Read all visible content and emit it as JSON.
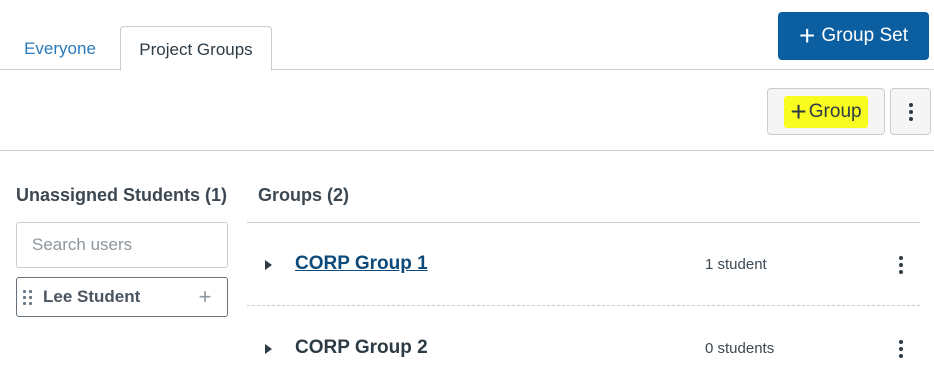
{
  "tabs": {
    "everyone": "Everyone",
    "project_groups": "Project Groups"
  },
  "header": {
    "add_group_set_label": "Group Set",
    "add_group_set_icon": "plus-icon"
  },
  "toolbar": {
    "add_group_label": "Group",
    "add_group_icon": "plus-icon",
    "more_icon": "kebab-icon",
    "highlight_color": "#f8fc1f"
  },
  "unassigned": {
    "title": "Unassigned Students (1)",
    "search_placeholder": "Search users",
    "students": [
      {
        "name": "Lee Student"
      }
    ]
  },
  "groups": {
    "title": "Groups (2)",
    "items": [
      {
        "name": "CORP Group 1",
        "count": "1 student"
      },
      {
        "name": "CORP Group 2",
        "count": "0 students"
      }
    ]
  },
  "colors": {
    "primary": "#0b5ea0",
    "tab_link": "#2b7abc",
    "group_link": "#0b4a7a"
  }
}
